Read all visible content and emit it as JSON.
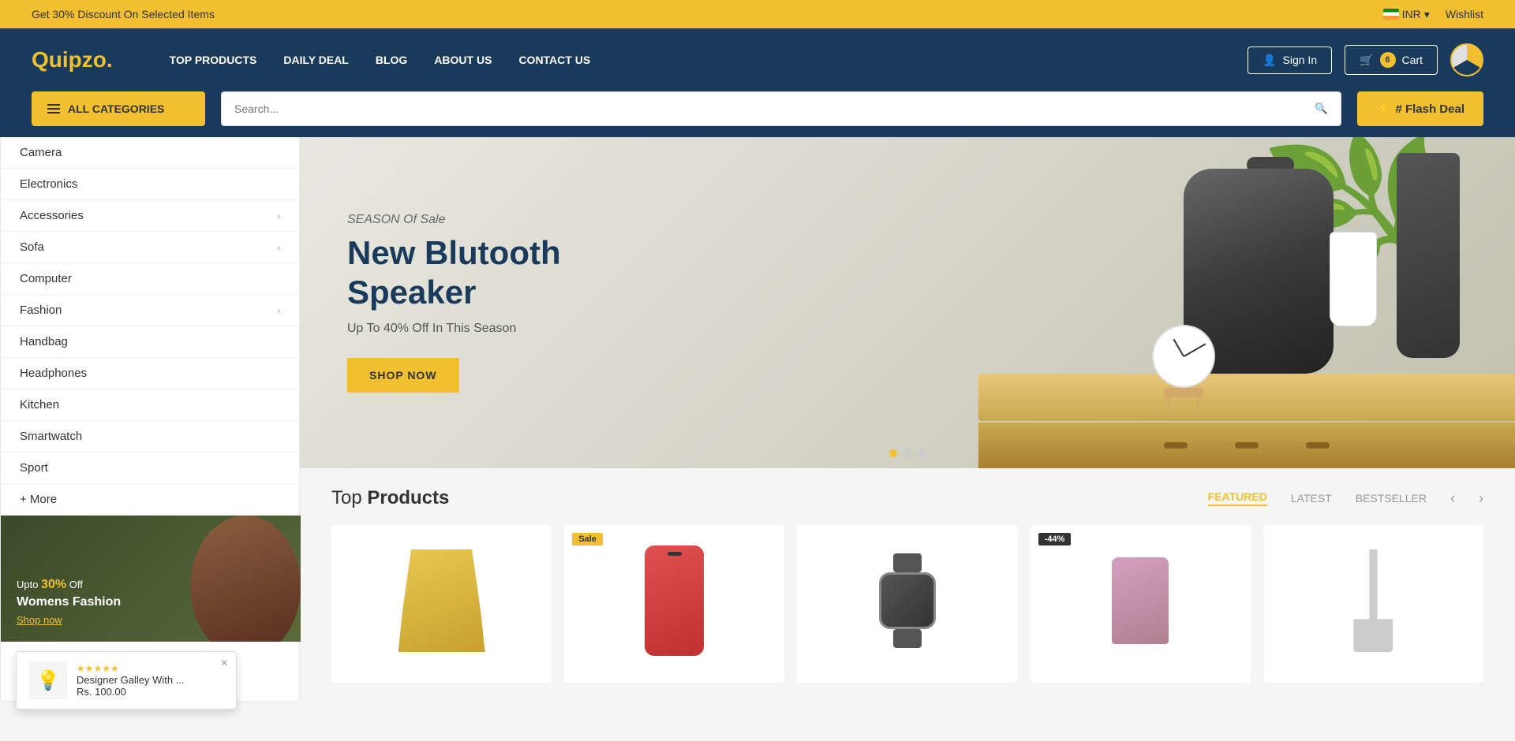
{
  "topBanner": {
    "text": "Get 30% Discount On Selected Items",
    "currency": "INR",
    "wishlist": "Wishlist"
  },
  "header": {
    "logo": "Quipzo",
    "logoDot": ".",
    "nav": [
      {
        "id": "top-products",
        "label": "TOP PRODUCTS"
      },
      {
        "id": "daily-deal",
        "label": "DAILY DEAL"
      },
      {
        "id": "blog",
        "label": "BLOG"
      },
      {
        "id": "about-us",
        "label": "ABOUT US"
      },
      {
        "id": "contact-us",
        "label": "CONTACT US"
      }
    ],
    "signIn": "Sign In",
    "cartCount": "6",
    "cart": "Cart"
  },
  "searchBar": {
    "allCategories": "ALL CATEGORIES",
    "placeholder": "Search...",
    "flashDeal": "# Flash Deal"
  },
  "sidebar": {
    "items": [
      {
        "label": "Camera",
        "hasArrow": false
      },
      {
        "label": "Electronics",
        "hasArrow": false
      },
      {
        "label": "Accessories",
        "hasArrow": true
      },
      {
        "label": "Sofa",
        "hasArrow": true
      },
      {
        "label": "Computer",
        "hasArrow": false
      },
      {
        "label": "Fashion",
        "hasArrow": true
      },
      {
        "label": "Handbag",
        "hasArrow": false
      },
      {
        "label": "Headphones",
        "hasArrow": false
      },
      {
        "label": "Kitchen",
        "hasArrow": false
      },
      {
        "label": "Smartwatch",
        "hasArrow": false
      },
      {
        "label": "Sport",
        "hasArrow": false
      }
    ],
    "more": "+ More"
  },
  "promoBanner": {
    "upto": "Upto",
    "percent": "30%",
    "off": "Off",
    "label": "Womens Fashion",
    "shopLink": "Shop now"
  },
  "hero": {
    "season": "SEASON Of Sale",
    "title": "New Blutooth Speaker",
    "subtitle": "Up To 40% Off In This Season",
    "btnLabel": "SHOP NOW"
  },
  "products": {
    "title": "Top",
    "titleBold": "Products",
    "tabs": [
      {
        "label": "FEATURED",
        "active": true
      },
      {
        "label": "LATEST",
        "active": false
      },
      {
        "label": "BESTSELLER",
        "active": false
      }
    ],
    "prevBtn": "‹",
    "nextBtn": "›"
  },
  "toast": {
    "productName": "Designer Galley With ...",
    "price": "Rs. 100.00",
    "stars": "★★★★★",
    "closeBtn": "×"
  }
}
